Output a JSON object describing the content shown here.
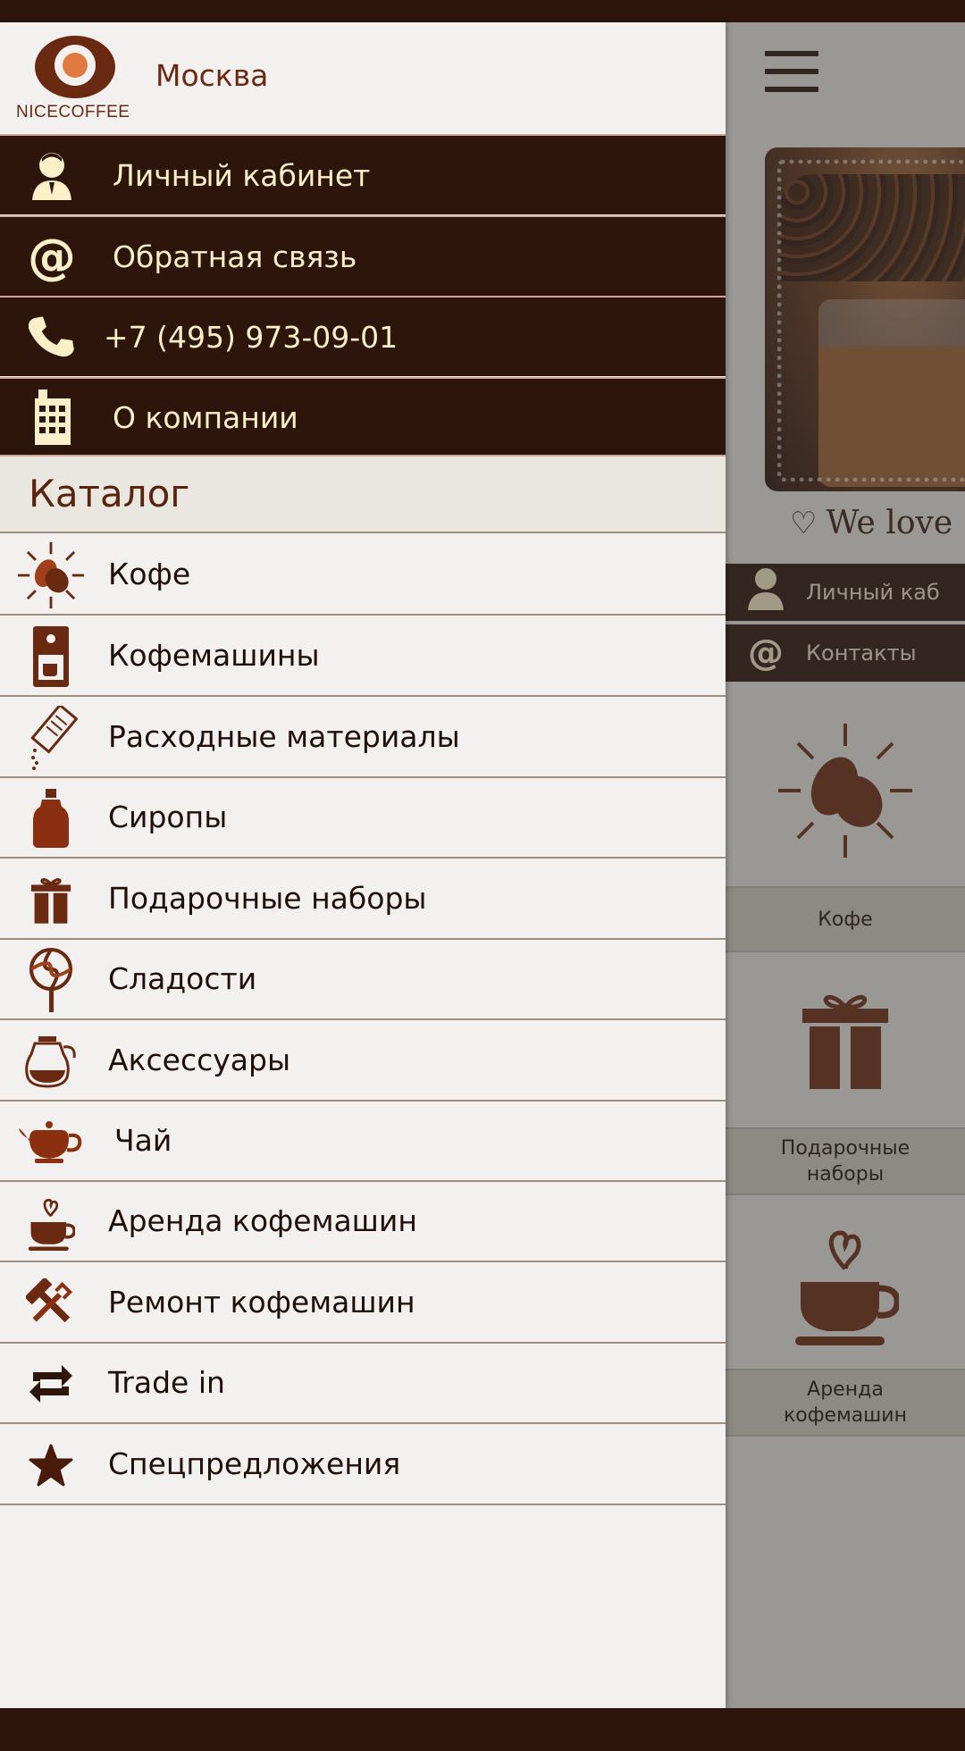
{
  "colors": {
    "dark": "#2d150b",
    "brand": "#6a2a12",
    "cream": "#fbf0c8",
    "panel": "#f3f1ef"
  },
  "header": {
    "logo_text": "NICECOFFEE",
    "city": "Москва"
  },
  "account_links": [
    {
      "label": "Личный кабинет",
      "icon": "user-icon"
    },
    {
      "label": "Обратная связь",
      "icon": "at-icon"
    },
    {
      "label": "+7 (495) 973-09-01",
      "icon": "phone-icon"
    },
    {
      "label": "О компании",
      "icon": "building-icon"
    }
  ],
  "catalog": {
    "title": "Каталог",
    "items": [
      {
        "label": "Кофе",
        "icon": "coffee-bean-icon"
      },
      {
        "label": "Кофемашины",
        "icon": "coffee-machine-icon"
      },
      {
        "label": "Расходные материалы",
        "icon": "sugar-pack-icon"
      },
      {
        "label": "Сиропы",
        "icon": "syrup-bottle-icon"
      },
      {
        "label": "Подарочные наборы",
        "icon": "gift-icon"
      },
      {
        "label": "Сладости",
        "icon": "lollipop-icon"
      },
      {
        "label": "Аксессуары",
        "icon": "coffee-pot-icon"
      },
      {
        "label": "Чай",
        "icon": "teapot-icon"
      },
      {
        "label": "Аренда кофемашин",
        "icon": "coffee-cup-heart-icon"
      },
      {
        "label": "Ремонт кофемашин",
        "icon": "tools-icon"
      },
      {
        "label": "Trade in",
        "icon": "exchange-icon"
      },
      {
        "label": "Спецпредложения",
        "icon": "star-icon"
      }
    ]
  },
  "background": {
    "slogan": "We love",
    "menu": [
      {
        "label": "Личный каб",
        "icon": "user-icon"
      },
      {
        "label": "Контакты",
        "icon": "at-icon"
      }
    ],
    "tiles": [
      {
        "label": "Кофе",
        "icon": "coffee-bean-icon"
      },
      {
        "label_line1": "Подарочные",
        "label_line2": "наборы",
        "icon": "gift-icon"
      },
      {
        "label_line1": "Аренда",
        "label_line2": "кофемашин",
        "icon": "coffee-cup-heart-icon"
      }
    ]
  }
}
